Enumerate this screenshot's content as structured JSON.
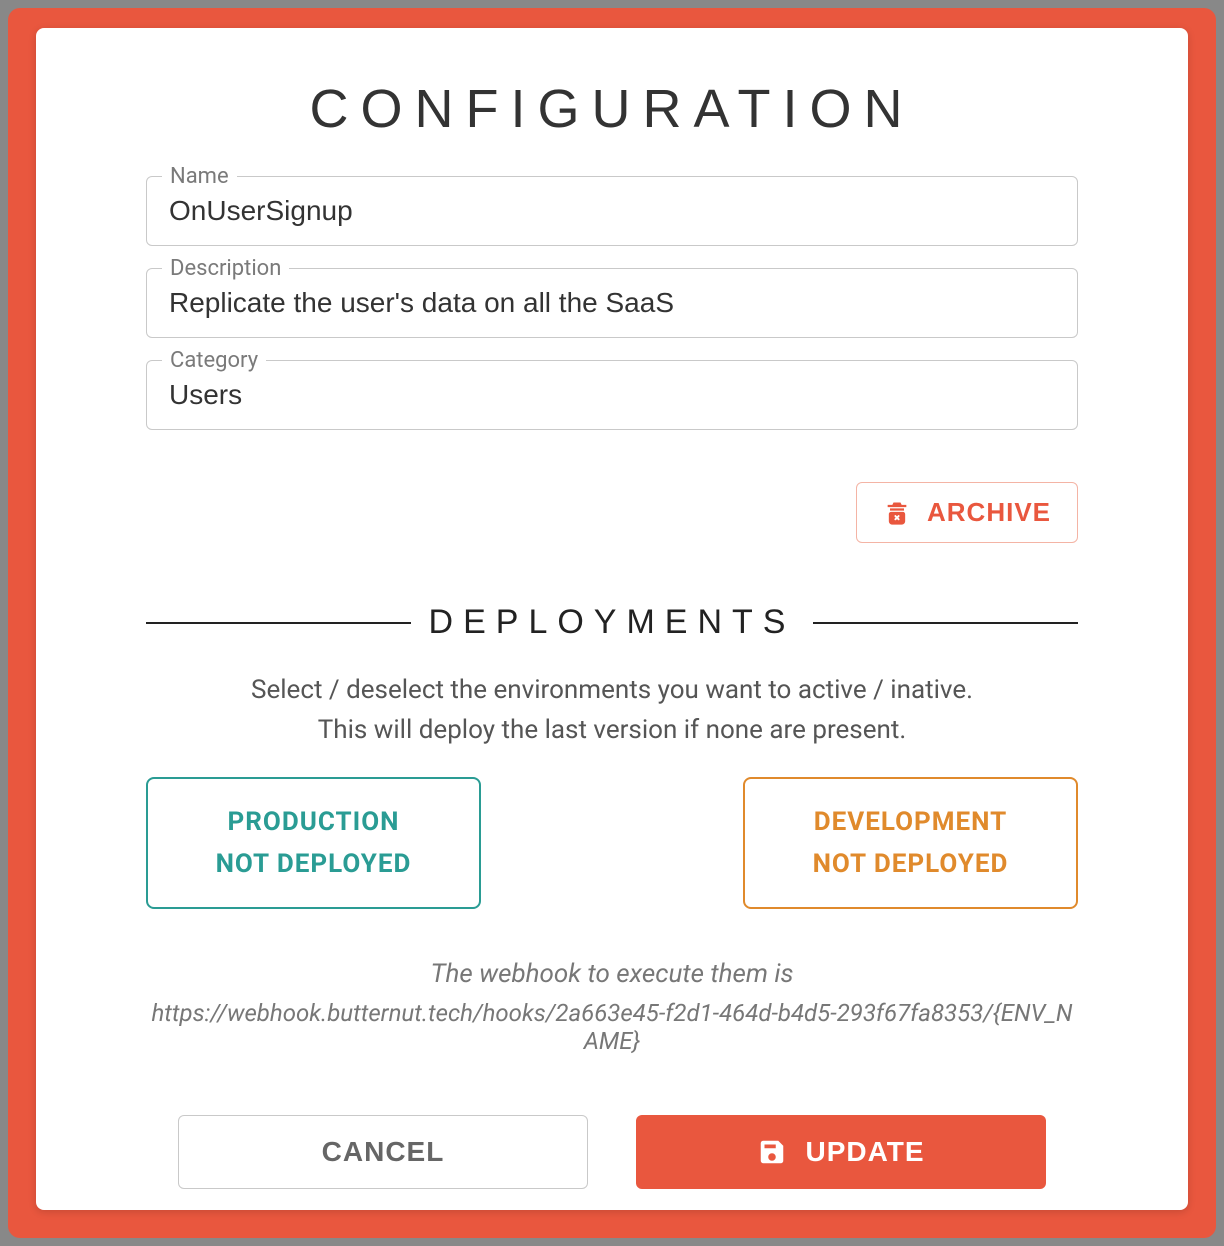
{
  "modal": {
    "title": "CONFIGURATION",
    "fields": {
      "name": {
        "label": "Name",
        "value": "OnUserSignup"
      },
      "description": {
        "label": "Description",
        "value": "Replicate the user's data on all the SaaS"
      },
      "category": {
        "label": "Category",
        "value": "Users"
      }
    },
    "archive": {
      "label": "ARCHIVE"
    },
    "deployments": {
      "title": "DEPLOYMENTS",
      "help_line1": "Select / deselect the environments you want to active / inative.",
      "help_line2": "This will deploy the last version if none are present.",
      "environments": [
        {
          "name": "PRODUCTION",
          "status": "NOT DEPLOYED",
          "color": "teal"
        },
        {
          "name": "DEVELOPMENT",
          "status": "NOT DEPLOYED",
          "color": "orange"
        }
      ],
      "webhook_caption": "The webhook to execute them is",
      "webhook_url": "https://webhook.butternut.tech/hooks/2a663e45-f2d1-464d-b4d5-293f67fa8353/{ENV_NAME}"
    },
    "buttons": {
      "cancel": "CANCEL",
      "update": "UPDATE"
    }
  }
}
